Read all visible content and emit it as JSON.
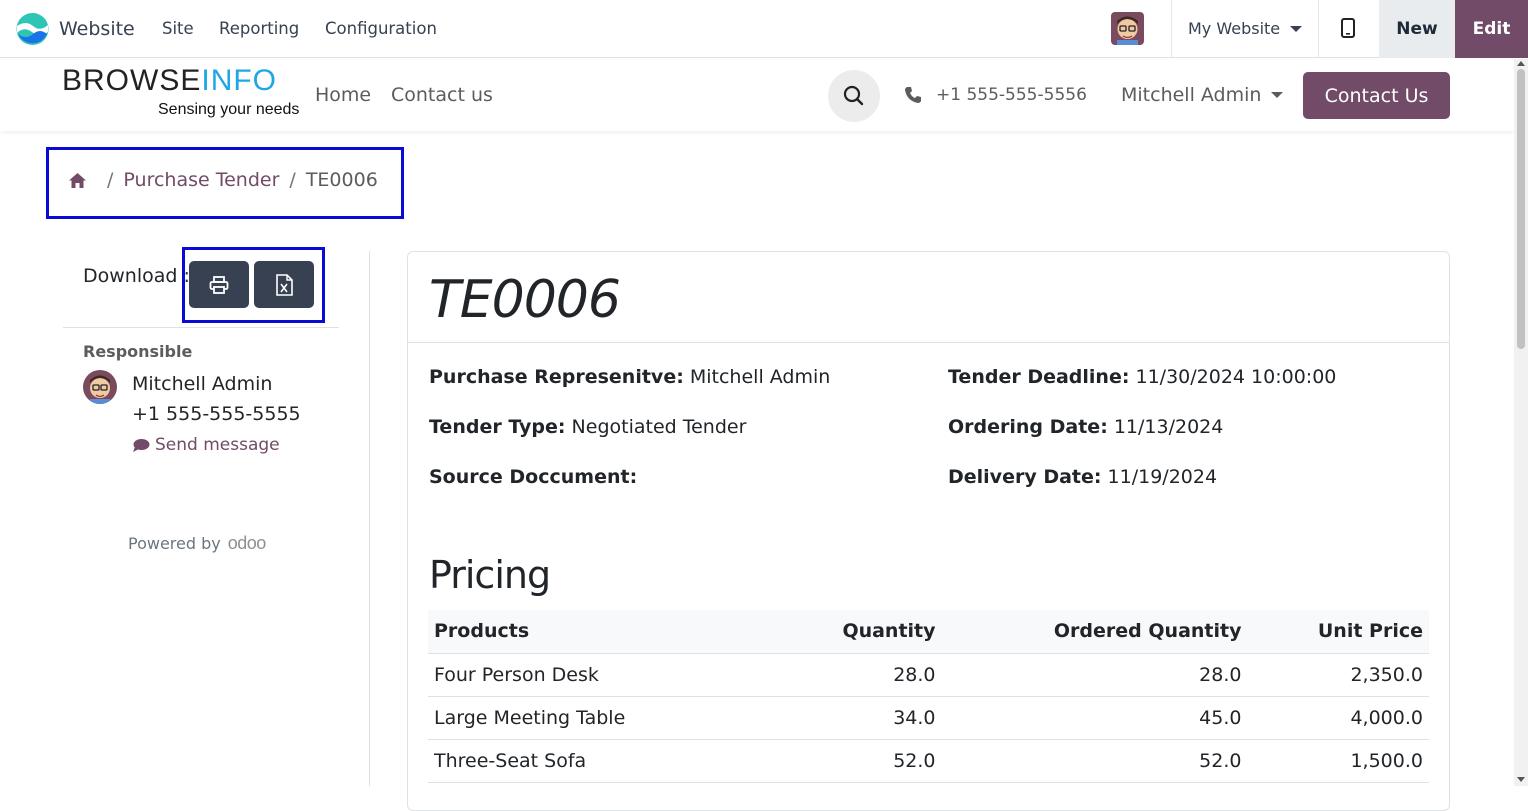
{
  "admin_bar": {
    "app_name": "Website",
    "menus": [
      "Site",
      "Reporting",
      "Configuration"
    ],
    "website_selector": "My Website",
    "new_label": "New",
    "edit_label": "Edit"
  },
  "site_header": {
    "brand_prefix": "BROWSE",
    "brand_suffix": "INFO",
    "brand_tagline": "Sensing your needs",
    "nav": [
      "Home",
      "Contact us"
    ],
    "phone": "+1 555-555-5556",
    "user": "Mitchell Admin",
    "contact_button": "Contact Us"
  },
  "breadcrumb": {
    "items": [
      "Purchase Tender",
      "TE0006"
    ]
  },
  "sidebar": {
    "download_label": "Download :",
    "responsible_label": "Responsible",
    "responsible_name": "Mitchell Admin",
    "responsible_phone": "+1 555-555-5555",
    "send_message": "Send message",
    "powered_by": "Powered by",
    "odoo": "odoo"
  },
  "tender": {
    "title": "TE0006",
    "fields": [
      {
        "label": "Purchase Represenitve:",
        "value": "Mitchell Admin"
      },
      {
        "label": "Tender Deadline:",
        "value": "11/30/2024 10:00:00"
      },
      {
        "label": "Tender Type:",
        "value": "Negotiated Tender"
      },
      {
        "label": "Ordering Date:",
        "value": "11/13/2024"
      },
      {
        "label": "Source Doccument:",
        "value": ""
      },
      {
        "label": "Delivery Date:",
        "value": "11/19/2024"
      }
    ],
    "pricing_heading": "Pricing",
    "columns": [
      "Products",
      "Quantity",
      "Ordered Quantity",
      "Unit Price"
    ],
    "rows": [
      [
        "Four Person Desk",
        "28.0",
        "28.0",
        "2,350.0"
      ],
      [
        "Large Meeting Table",
        "34.0",
        "45.0",
        "4,000.0"
      ],
      [
        "Three-Seat Sofa",
        "52.0",
        "52.0",
        "1,500.0"
      ]
    ]
  },
  "colors": {
    "primary": "#714b67",
    "highlight_box": "#0a0ad6",
    "dark_button": "#374151"
  }
}
